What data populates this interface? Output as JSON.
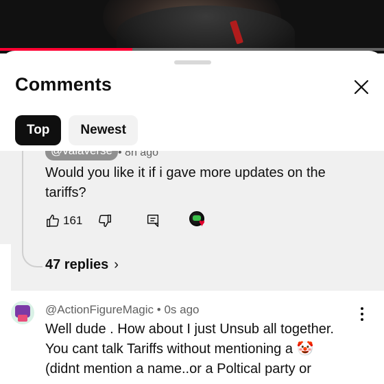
{
  "video": {
    "progress_fraction": 0.345,
    "accent": "#ff0033"
  },
  "sheet": {
    "title": "Comments",
    "close_icon": "close-icon",
    "sort_chips": [
      {
        "label": "Top",
        "active": true
      },
      {
        "label": "Newest",
        "active": false
      }
    ]
  },
  "highlighted_comment": {
    "handle": "@valaverse",
    "time": "• 8h ago",
    "text": "Would you like it if i gave more updates on the tariffs?",
    "likes": "161",
    "creator_heart": "♥",
    "replies_label": "47 replies",
    "replies_chevron": "›",
    "icons": [
      "thumbs-up-icon",
      "thumbs-down-icon",
      "reply-icon",
      "creator-heart-icon"
    ]
  },
  "comment": {
    "author": "@ActionFigureMagic",
    "time": "• 0s ago",
    "text": "Well dude . How about I just Unsub all together.\nYou cant talk Tariffs without mentioning a 🤡\n(didnt mention a name..or a Poltical party or",
    "menu_icon": "more-vert-icon"
  },
  "colors": {
    "chip_active_bg": "#0f0f0f",
    "chip_bg": "#f2f2f2",
    "highlight_bg": "#f0f0f0",
    "secondary_text": "#606060"
  }
}
